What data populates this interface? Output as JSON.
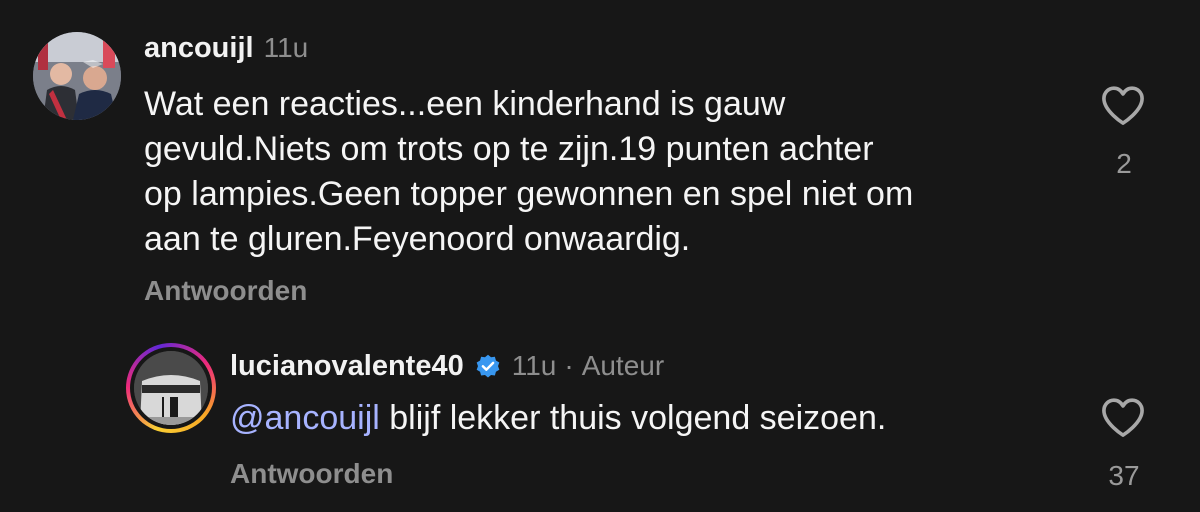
{
  "comments": [
    {
      "username": "ancouijl",
      "time": "11u",
      "text": "Wat een reacties...een kinderhand is gauw\ngevuld.Niets om trots op te zijn.19 punten achter\nop lampies.Geen topper gewonnen en spel niet om\naan te gluren.Feyenoord onwaardig.",
      "reply_label": "Antwoorden",
      "likes": "2"
    },
    {
      "username": "lucianovalente40",
      "verified": true,
      "time": "11u",
      "separator": "·",
      "role": "Auteur",
      "mention": "@ancouijl",
      "text": " blijf lekker thuis volgend seizoen.",
      "reply_label": "Antwoorden",
      "likes": "37"
    }
  ],
  "icons": {
    "like": "heart-outline-icon",
    "verified": "verified-badge-icon"
  },
  "colors": {
    "background": "#171717",
    "mention": "#a7b3ff",
    "muted": "#8e8e8e",
    "verified": "#3897f0"
  }
}
